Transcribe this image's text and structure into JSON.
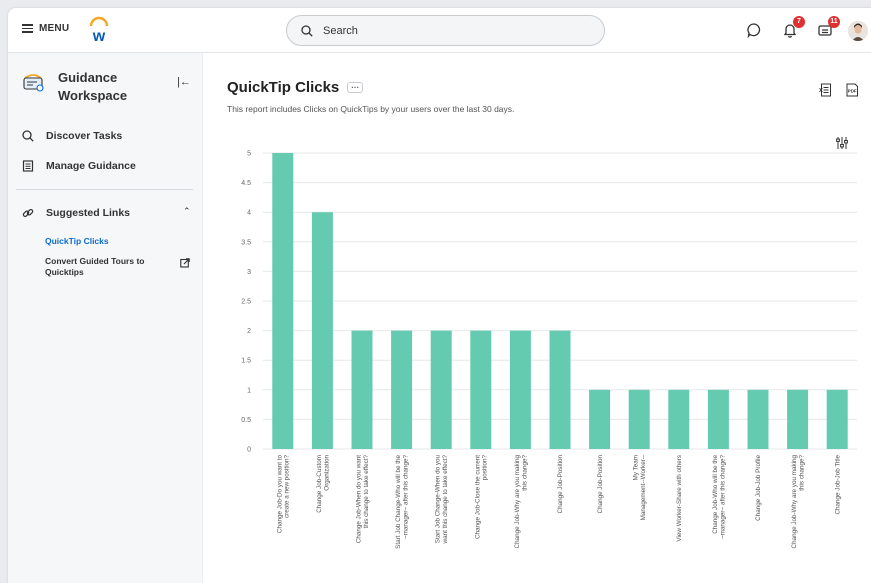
{
  "topbar": {
    "menu_label": "MENU",
    "search_placeholder": "Search",
    "notifications_badge": "7",
    "inbox_badge": "11"
  },
  "sidebar": {
    "workspace_title": "Guidance Workspace",
    "items": [
      {
        "label": "Discover Tasks",
        "icon": "search-icon"
      },
      {
        "label": "Manage Guidance",
        "icon": "document-icon"
      }
    ],
    "section": {
      "label": "Suggested Links",
      "icon": "link-icon"
    },
    "links": [
      {
        "label": "QuickTip Clicks",
        "active": true
      },
      {
        "label": "Convert Guided Tours to Quicktips",
        "active": false
      }
    ]
  },
  "report": {
    "title": "QuickTip Clicks",
    "description": "This report includes Clicks on QuickTips by your users over the last 30 days."
  },
  "colors": {
    "bar": "#64cbb0",
    "accent_link": "#0b6bcb",
    "badge": "#de3030"
  },
  "chart_data": {
    "type": "bar",
    "ylim": [
      0,
      5
    ],
    "yticks": [
      "0",
      "0.5",
      "1",
      "1.5",
      "2",
      "2.5",
      "3",
      "3.5",
      "4",
      "4.5",
      "5"
    ],
    "categories": [
      [
        "Change Job-Do you want to",
        "create a new position?"
      ],
      [
        "Change Job-Custom",
        "Organization"
      ],
      [
        "Change Job-When do you want",
        "this change to take effect?"
      ],
      [
        "Start Job Change-Who will be the",
        "~manager~ after this change?"
      ],
      [
        "Start Job Change-When do you",
        "want this change to take effect?"
      ],
      [
        "Change Job-Close the current",
        "position?"
      ],
      [
        "Change Job-Why are you making",
        "this change?"
      ],
      [
        "Change Job-Position"
      ],
      [
        "Change Job-Position"
      ],
      [
        "My Team",
        "Management--Worker--"
      ],
      [
        "View Worker-Share with others"
      ],
      [
        "Change Job-Who will be the",
        "~manager~ after this change?"
      ],
      [
        "Change Job-Job Profile"
      ],
      [
        "Change Job-Why are you making",
        "this change?"
      ],
      [
        "Change Job-Job Title"
      ]
    ],
    "values": [
      5,
      4,
      2,
      2,
      2,
      2,
      2,
      2,
      1,
      1,
      1,
      1,
      1,
      1,
      1
    ]
  }
}
